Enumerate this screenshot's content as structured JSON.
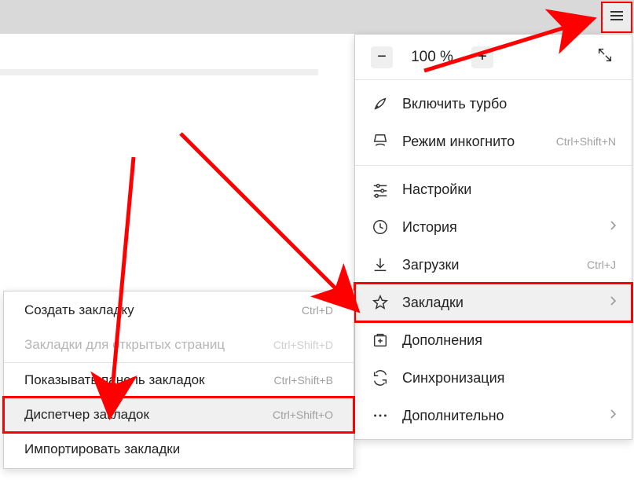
{
  "zoom": {
    "value": "100 %"
  },
  "main_menu": {
    "turbo": {
      "label": "Включить турбо"
    },
    "incognito": {
      "label": "Режим инкогнито",
      "shortcut": "Ctrl+Shift+N"
    },
    "settings": {
      "label": "Настройки"
    },
    "history": {
      "label": "История"
    },
    "downloads": {
      "label": "Загрузки",
      "shortcut": "Ctrl+J"
    },
    "bookmarks": {
      "label": "Закладки"
    },
    "addons": {
      "label": "Дополнения"
    },
    "sync": {
      "label": "Синхронизация"
    },
    "more": {
      "label": "Дополнительно"
    }
  },
  "sub_menu": {
    "create": {
      "label": "Создать закладку",
      "shortcut": "Ctrl+D"
    },
    "open_pages": {
      "label": "Закладки для открытых страниц",
      "shortcut": "Ctrl+Shift+D"
    },
    "show_bar": {
      "label": "Показывать панель закладок",
      "shortcut": "Ctrl+Shift+B"
    },
    "manager": {
      "label": "Диспетчер закладок",
      "shortcut": "Ctrl+Shift+O"
    },
    "import": {
      "label": "Импортировать закладки"
    }
  }
}
